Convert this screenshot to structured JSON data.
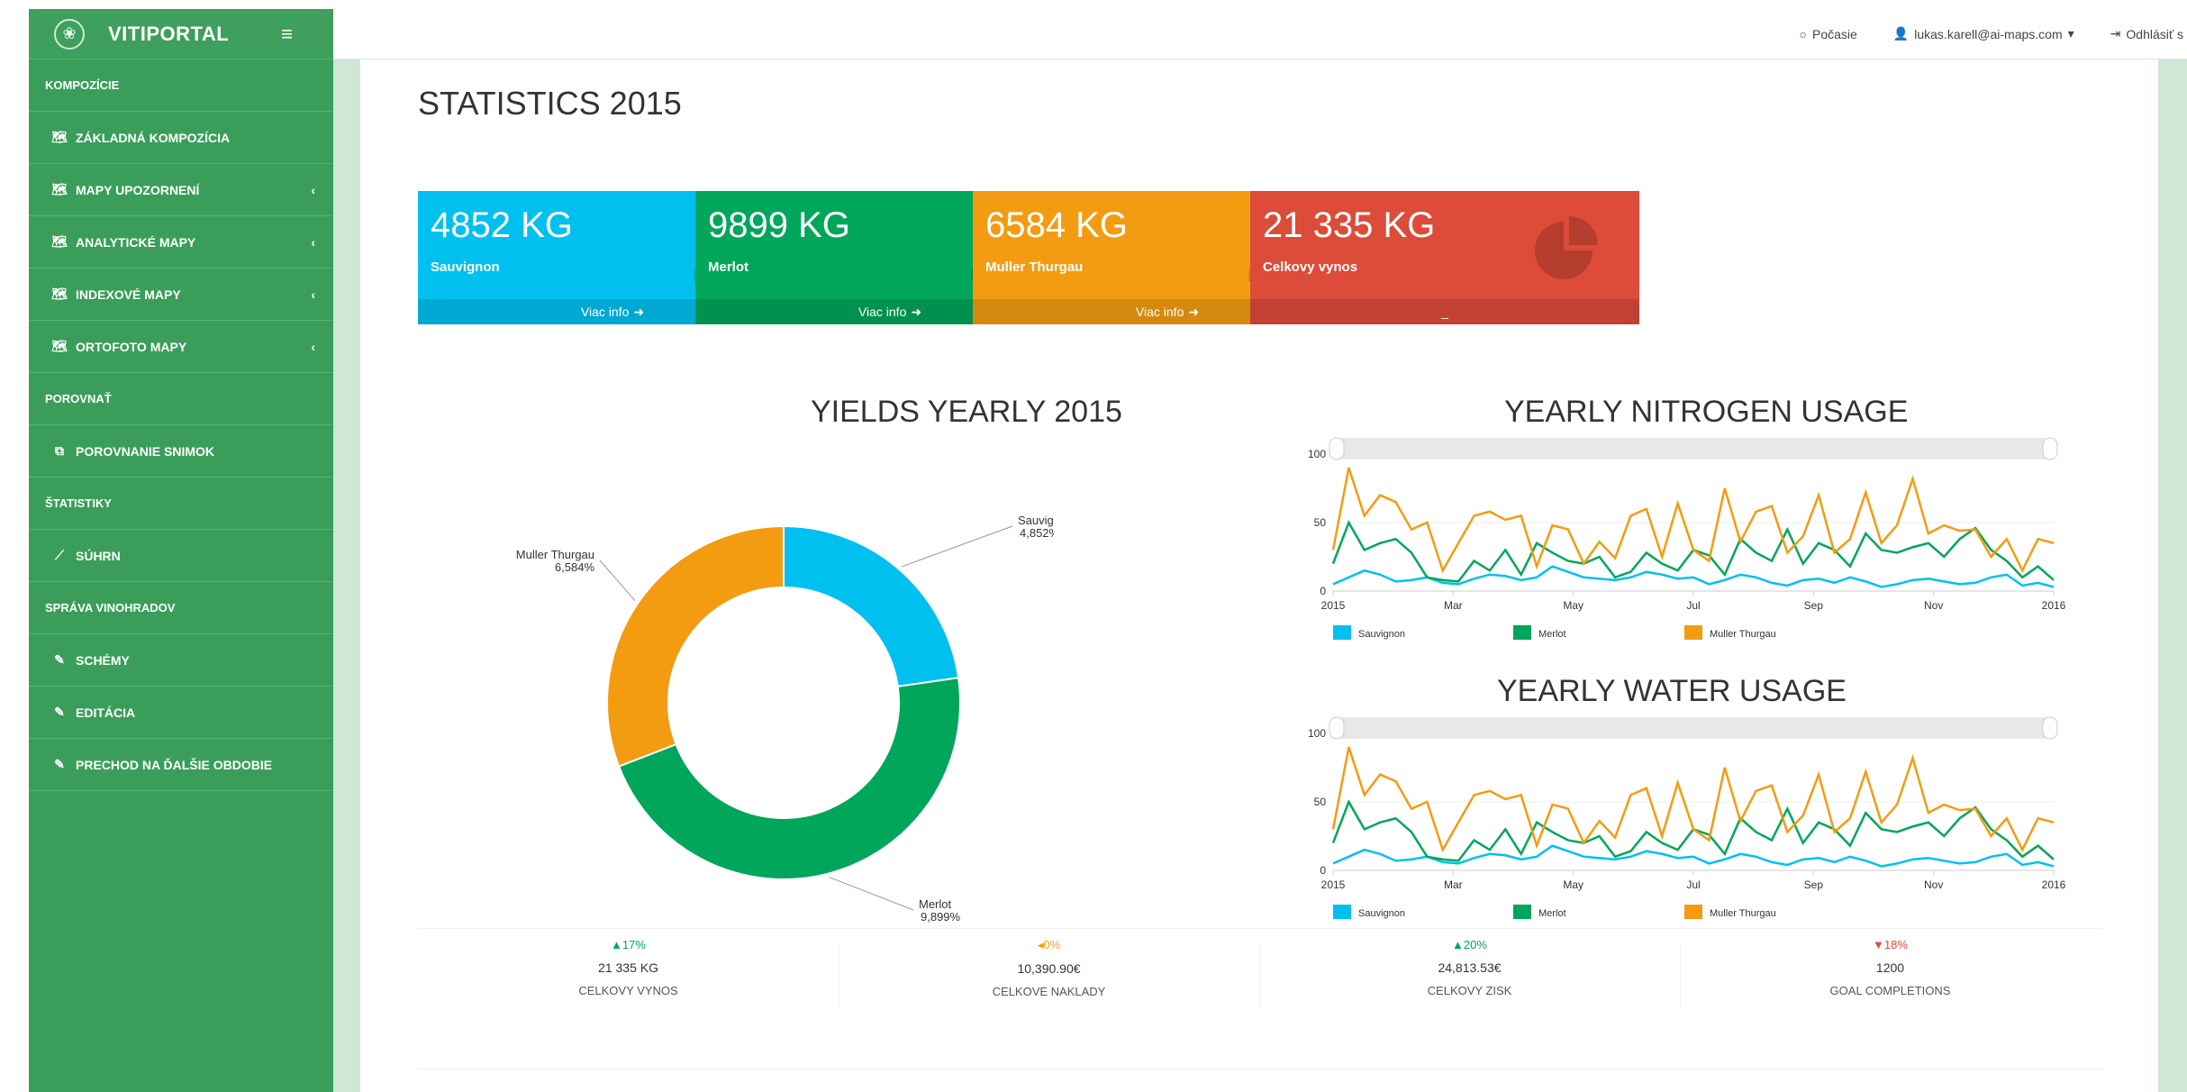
{
  "brand": {
    "title": "VITIPORTAL",
    "menu_toggle": "≡",
    "logo_glyph": "❀"
  },
  "sidebar": {
    "rows": [
      {
        "type": "section",
        "label": "KOMPOZÍCIE"
      },
      {
        "type": "item",
        "label": "ZÁKLADNÁ KOMPOZÍCIA",
        "icon": "map-icon",
        "chevron": ""
      },
      {
        "type": "item",
        "label": "MAPY UPOZORNENÍ",
        "icon": "map-icon",
        "chevron": "‹"
      },
      {
        "type": "item",
        "label": "ANALYTICKÉ MAPY",
        "icon": "map-icon",
        "chevron": "‹"
      },
      {
        "type": "item",
        "label": "INDEXOVÉ MAPY",
        "icon": "map-icon",
        "chevron": "‹"
      },
      {
        "type": "item",
        "label": "ORTOFOTO MAPY",
        "icon": "map-icon",
        "chevron": "‹"
      },
      {
        "type": "section",
        "label": "POROVNAŤ"
      },
      {
        "type": "item",
        "label": "POROVNANIE SNIMOK",
        "icon": "copy-icon",
        "chevron": ""
      },
      {
        "type": "section",
        "label": "ŠTATISTIKY"
      },
      {
        "type": "item",
        "label": "SÚHRN",
        "icon": "line-chart-icon",
        "chevron": ""
      },
      {
        "type": "section",
        "label": "SPRÁVA VINOHRADOV"
      },
      {
        "type": "item",
        "label": "SCHÉMY",
        "icon": "edit-icon",
        "chevron": ""
      },
      {
        "type": "item",
        "label": "EDITÁCIA",
        "icon": "edit-icon",
        "chevron": ""
      },
      {
        "type": "item",
        "label": "PRECHOD NA ĎALŠIE OBDOBIE",
        "icon": "edit-icon",
        "chevron": ""
      }
    ]
  },
  "topbar": {
    "weather": "Počasie",
    "user": "lukas.karell@ai-maps.com",
    "logout": "Odhlásiť s"
  },
  "page": {
    "title": "STATISTICS 2015"
  },
  "boxes": [
    {
      "value": "4852 KG",
      "label": "Sauvignon",
      "footer": "Viac info",
      "color": "#00c0ef",
      "icon": "leaf-icon"
    },
    {
      "value": "9899 KG",
      "label": "Merlot",
      "footer": "Viac info",
      "color": "#00a65a",
      "icon": "leaf-icon"
    },
    {
      "value": "6584 KG",
      "label": "Muller Thurgau",
      "footer": "Viac info",
      "color": "#f39c12",
      "icon": "leaf-icon"
    },
    {
      "value": "21 335 KG",
      "label": "Celkovy vynos",
      "footer": "_",
      "color": "#dd4b39",
      "icon": "pie-chart-icon"
    }
  ],
  "charts_titles": {
    "yields": "YIELDS YEARLY 2015",
    "nitrogen": "YEARLY NITROGEN USAGE",
    "water": "YEARLY WATER USAGE"
  },
  "chart_data": [
    {
      "type": "pie",
      "title": "YIELDS YEARLY 2015",
      "slices": [
        {
          "name": "Sauvignon",
          "value": 4852,
          "label": "4,852%",
          "color": "#00c0ef"
        },
        {
          "name": "Merlot",
          "value": 9899,
          "label": "9,899%",
          "color": "#00a65a"
        },
        {
          "name": "Muller Thurgau",
          "value": 6584,
          "label": "6,584%",
          "color": "#f39c12"
        }
      ]
    },
    {
      "type": "line",
      "title": "YEARLY NITROGEN USAGE",
      "x_ticks": [
        "2015",
        "Mar",
        "May",
        "Jul",
        "Sep",
        "Nov",
        "2016"
      ],
      "y_ticks": [
        "0",
        "50",
        "100"
      ],
      "ylim": [
        0,
        100
      ],
      "series": [
        {
          "name": "Sauvignon",
          "color": "#00c0ef",
          "values": [
            5,
            10,
            15,
            12,
            7,
            8,
            10,
            6,
            5,
            9,
            12,
            11,
            8,
            10,
            18,
            14,
            10,
            9,
            8,
            10,
            14,
            12,
            9,
            10,
            5,
            8,
            12,
            10,
            6,
            4,
            8,
            9,
            6,
            10,
            7,
            3,
            5,
            8,
            9,
            7,
            5,
            6,
            10,
            12,
            4,
            6,
            3
          ]
        },
        {
          "name": "Merlot",
          "color": "#00a65a",
          "values": [
            20,
            50,
            30,
            35,
            38,
            28,
            10,
            8,
            7,
            22,
            15,
            30,
            12,
            35,
            28,
            22,
            20,
            25,
            10,
            14,
            28,
            20,
            15,
            30,
            26,
            12,
            38,
            28,
            22,
            45,
            20,
            35,
            30,
            18,
            42,
            30,
            28,
            32,
            35,
            25,
            38,
            46,
            30,
            22,
            10,
            18,
            8
          ]
        },
        {
          "name": "Muller Thurgau",
          "color": "#f39c12",
          "values": [
            30,
            90,
            55,
            70,
            65,
            45,
            50,
            15,
            35,
            55,
            58,
            52,
            55,
            18,
            48,
            45,
            20,
            36,
            24,
            55,
            60,
            25,
            64,
            30,
            22,
            75,
            36,
            58,
            62,
            28,
            40,
            70,
            28,
            38,
            72,
            35,
            48,
            82,
            42,
            48,
            44,
            45,
            25,
            38,
            15,
            38,
            35
          ]
        }
      ]
    },
    {
      "type": "line",
      "title": "YEARLY WATER USAGE",
      "x_ticks": [
        "2015",
        "Mar",
        "May",
        "Jul",
        "Sep",
        "Nov",
        "2016"
      ],
      "y_ticks": [
        "0",
        "50",
        "100"
      ],
      "ylim": [
        0,
        100
      ],
      "series": [
        {
          "name": "Sauvignon",
          "color": "#00c0ef",
          "values": [
            5,
            10,
            15,
            12,
            7,
            8,
            10,
            6,
            5,
            9,
            12,
            11,
            8,
            10,
            18,
            14,
            10,
            9,
            8,
            10,
            14,
            12,
            9,
            10,
            5,
            8,
            12,
            10,
            6,
            4,
            8,
            9,
            6,
            10,
            7,
            3,
            5,
            8,
            9,
            7,
            5,
            6,
            10,
            12,
            4,
            6,
            3
          ]
        },
        {
          "name": "Merlot",
          "color": "#00a65a",
          "values": [
            20,
            50,
            30,
            35,
            38,
            28,
            10,
            8,
            7,
            22,
            15,
            30,
            12,
            35,
            28,
            22,
            20,
            25,
            10,
            14,
            28,
            20,
            15,
            30,
            26,
            12,
            38,
            28,
            22,
            45,
            20,
            35,
            30,
            18,
            42,
            30,
            28,
            32,
            35,
            25,
            38,
            46,
            30,
            22,
            10,
            18,
            8
          ]
        },
        {
          "name": "Muller Thurgau",
          "color": "#f39c12",
          "values": [
            30,
            90,
            55,
            70,
            65,
            45,
            50,
            15,
            35,
            55,
            58,
            52,
            55,
            18,
            48,
            45,
            20,
            36,
            24,
            55,
            60,
            25,
            64,
            30,
            22,
            75,
            36,
            58,
            62,
            28,
            40,
            70,
            28,
            38,
            72,
            35,
            48,
            82,
            42,
            48,
            44,
            45,
            25,
            38,
            15,
            38,
            35
          ]
        }
      ]
    }
  ],
  "stats": [
    {
      "pct": "▲17%",
      "pct_color": "#00a65a",
      "value": "21 335 KG",
      "label": "CELKOVY VYNOS"
    },
    {
      "pct": "◂0%",
      "pct_color": "#f39c12",
      "value": "10,390.90€",
      "label": "CELKOVE NAKLADY"
    },
    {
      "pct": "▲20%",
      "pct_color": "#00a65a",
      "value": "24,813.53€",
      "label": "CELKOVY ZISK"
    },
    {
      "pct": "▼18%",
      "pct_color": "#dd4b39",
      "value": "1200",
      "label": "GOAL COMPLETIONS"
    }
  ]
}
